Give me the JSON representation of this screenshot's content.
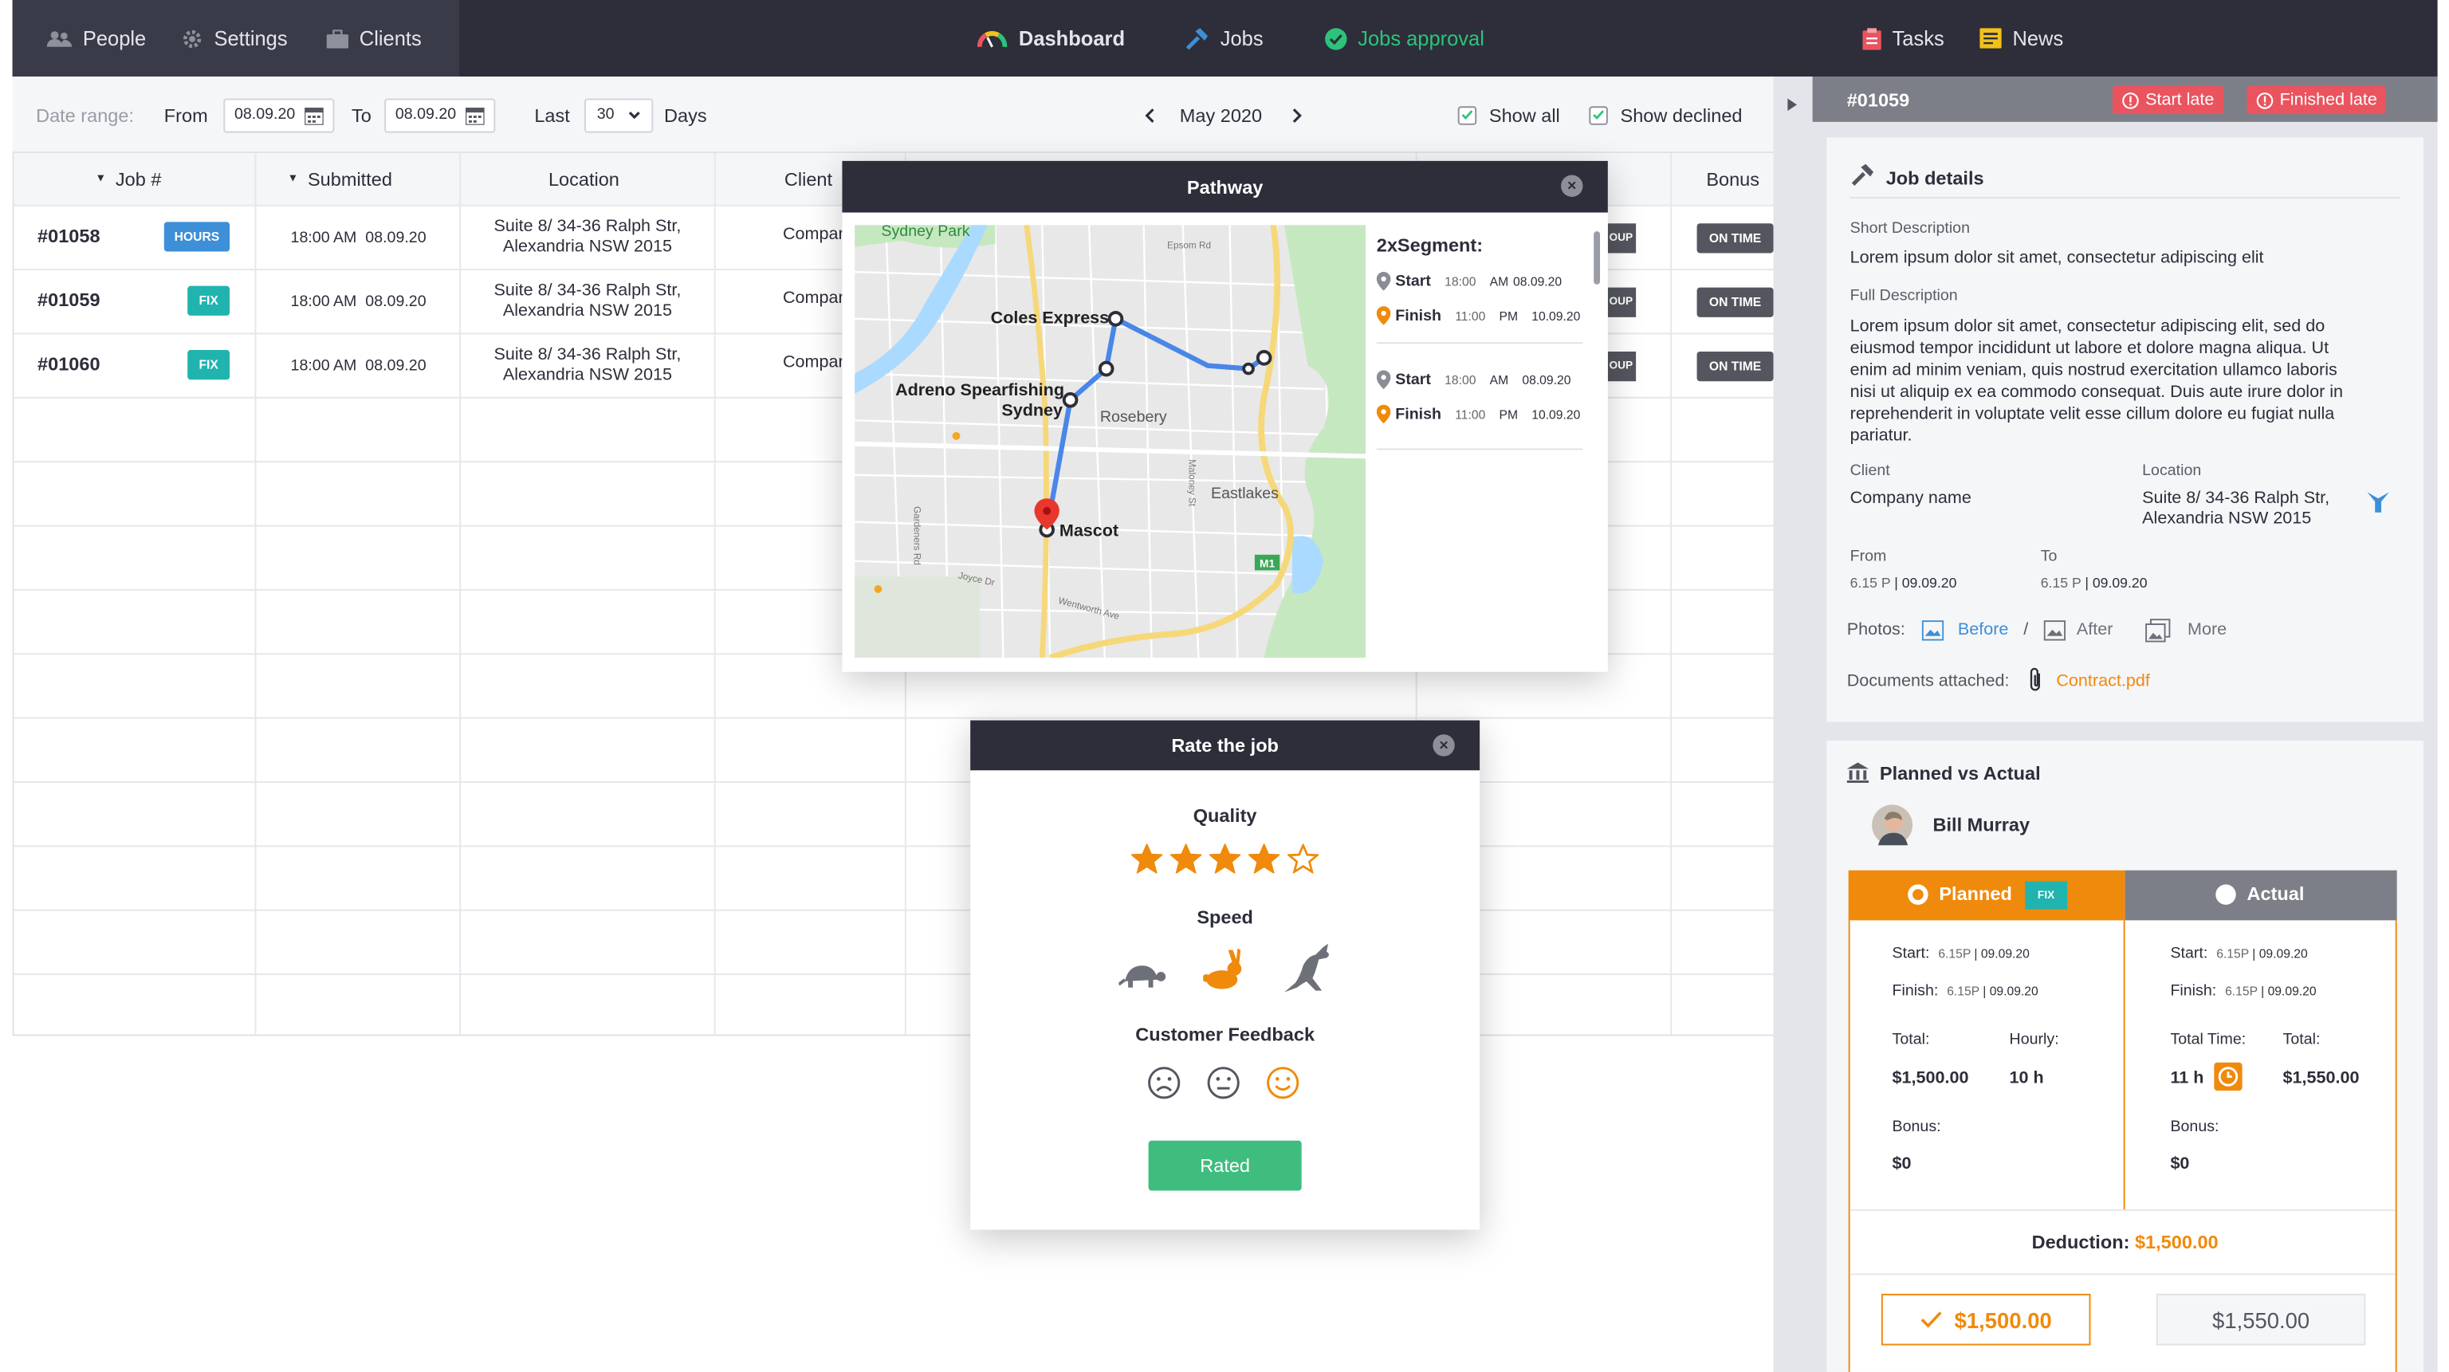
{
  "nav": {
    "left": [
      {
        "label": "People",
        "icon": "people-icon"
      },
      {
        "label": "Settings",
        "icon": "gear-icon"
      },
      {
        "label": "Clients",
        "icon": "briefcase-icon"
      }
    ],
    "center": [
      {
        "label": "Dashboard",
        "icon": "gauge-icon"
      },
      {
        "label": "Jobs",
        "icon": "hammer-icon"
      },
      {
        "label": "Jobs approval",
        "icon": "check-circle-icon",
        "active": true
      }
    ],
    "right": [
      {
        "label": "Tasks",
        "icon": "clipboard-icon"
      },
      {
        "label": "News",
        "icon": "newspaper-icon"
      }
    ]
  },
  "toolbar": {
    "date_range_label": "Date range:",
    "from_label": "From",
    "from_value": "08.09.20",
    "to_label": "To",
    "to_value": "08.09.20",
    "last_label": "Last",
    "last_value": "30",
    "days_label": "Days",
    "month": "May 2020",
    "show_all": "Show all",
    "show_declined": "Show declined"
  },
  "table": {
    "headers": {
      "job": "Job #",
      "submitted": "Submitted",
      "location": "Location",
      "client": "Client",
      "bonus": "Bonus"
    },
    "rows": [
      {
        "job": "#01058",
        "type": "HOURS",
        "time": "18:00 AM",
        "date": "08.09.20",
        "loc1": "Suite 8/ 34-36 Ralph Str,",
        "loc2": "Alexandria NSW 2015",
        "client": "Company na",
        "group": "OUP",
        "bonus": "ON TIME"
      },
      {
        "job": "#01059",
        "type": "FIX",
        "time": "18:00 AM",
        "date": "08.09.20",
        "loc1": "Suite 8/ 34-36 Ralph Str,",
        "loc2": "Alexandria NSW 2015",
        "client": "Company na",
        "group": "OUP",
        "bonus": "ON TIME"
      },
      {
        "job": "#01060",
        "type": "FIX",
        "time": "18:00 AM",
        "date": "08.09.20",
        "loc1": "Suite 8/ 34-36 Ralph Str,",
        "loc2": "Alexandria NSW 2015",
        "client": "Company na",
        "group": "OUP",
        "bonus": "ON TIME"
      }
    ]
  },
  "pathway": {
    "title": "Pathway",
    "map_labels": {
      "park": "Sydney Park",
      "coles": "Coles Express",
      "adreno1": "Adreno Spearfishing",
      "adreno2": "Sydney",
      "rosebery": "Rosebery",
      "eastlakes": "Eastlakes",
      "mascot": "Mascot",
      "m1": "M1",
      "epsom": "Epsom Rd",
      "wentworth": "Wentworth Ave",
      "joyce": "Joyce Dr",
      "gardeners": "Gardeners Rd",
      "maloney": "Maloney St"
    },
    "segment_title": "2xSegment:",
    "segments": [
      {
        "start_label": "Start",
        "start_time": "18:00",
        "start_ampm": "AM",
        "start_date": "08.09.20",
        "finish_label": "Finish",
        "finish_time": "11:00",
        "finish_ampm": "PM",
        "finish_date": "10.09.20"
      },
      {
        "start_label": "Start",
        "start_time": "18:00",
        "start_ampm": "AM",
        "start_date": "08.09.20",
        "finish_label": "Finish",
        "finish_time": "11:00",
        "finish_ampm": "PM",
        "finish_date": "10.09.20"
      }
    ]
  },
  "rate": {
    "title": "Rate the job",
    "quality_label": "Quality",
    "quality_stars": 4,
    "quality_max": 5,
    "speed_label": "Speed",
    "speed_selected": "rabbit",
    "feedback_label": "Customer Feedback",
    "feedback_selected": "happy",
    "button": "Rated"
  },
  "detail": {
    "job_id": "#01059",
    "start_late": "Start late",
    "finished_late": "Finished late",
    "section_title": "Job details",
    "short_desc_label": "Short Description",
    "short_desc": "Lorem ipsum dolor sit amet, consectetur adipiscing elit",
    "full_desc_label": "Full Description",
    "full_desc_lines": [
      "Lorem ipsum dolor sit amet, consectetur adipiscing elit, sed do",
      "eiusmod tempor incididunt ut labore et dolore magna aliqua. Ut",
      "enim ad minim veniam, quis nostrud exercitation ullamco laboris",
      "nisi ut aliquip ex ea commodo consequat. Duis aute irure dolor in",
      "reprehenderit in voluptate velit esse cillum dolore eu fugiat nulla",
      "pariatur."
    ],
    "client_label": "Client",
    "client": "Company name",
    "location_label": "Location",
    "location1": "Suite 8/ 34-36 Ralph Str,",
    "location2": "Alexandria NSW 2015",
    "from_label": "From",
    "from_time": "6.15 P",
    "from_date": "09.09.20",
    "to_label": "To",
    "to_time": "6.15 P",
    "to_date": "09.09.20",
    "photos_label": "Photos:",
    "before": "Before",
    "slash": "/",
    "after": "After",
    "more": "More",
    "docs_label": "Documents attached:",
    "doc": "Contract.pdf"
  },
  "pva": {
    "title": "Planned vs Actual",
    "person": "Bill Murray",
    "planned_tab": "Planned",
    "planned_badge": "FIX",
    "actual_tab": "Actual",
    "planned": {
      "start_label": "Start:",
      "start_time": "6.15P",
      "start_date": "09.09.20",
      "finish_label": "Finish:",
      "finish_time": "6.15P",
      "finish_date": "09.09.20",
      "total_label": "Total:",
      "total": "$1,500.00",
      "hourly_label": "Hourly:",
      "hourly": "10 h",
      "bonus_label": "Bonus:",
      "bonus": "$0"
    },
    "actual": {
      "start_label": "Start:",
      "start_time": "6.15P",
      "start_date": "09.09.20",
      "finish_label": "Finish:",
      "finish_time": "6.15P",
      "finish_date": "09.09.20",
      "total_time_label": "Total Time:",
      "total_time": "11 h",
      "total_label": "Total:",
      "total": "$1,550.00",
      "bonus_label": "Bonus:",
      "bonus": "$0"
    },
    "deduction_label": "Deduction:",
    "deduction": "$1,500.00",
    "planned_amount": "$1,500.00",
    "actual_amount": "$1,550.00"
  },
  "colors": {
    "accent": "#f08a0c",
    "green": "#2cc37a",
    "dark": "#2d2e3a",
    "blue": "#3d8fd8",
    "teal": "#21b4ae",
    "red": "#e9545f"
  }
}
